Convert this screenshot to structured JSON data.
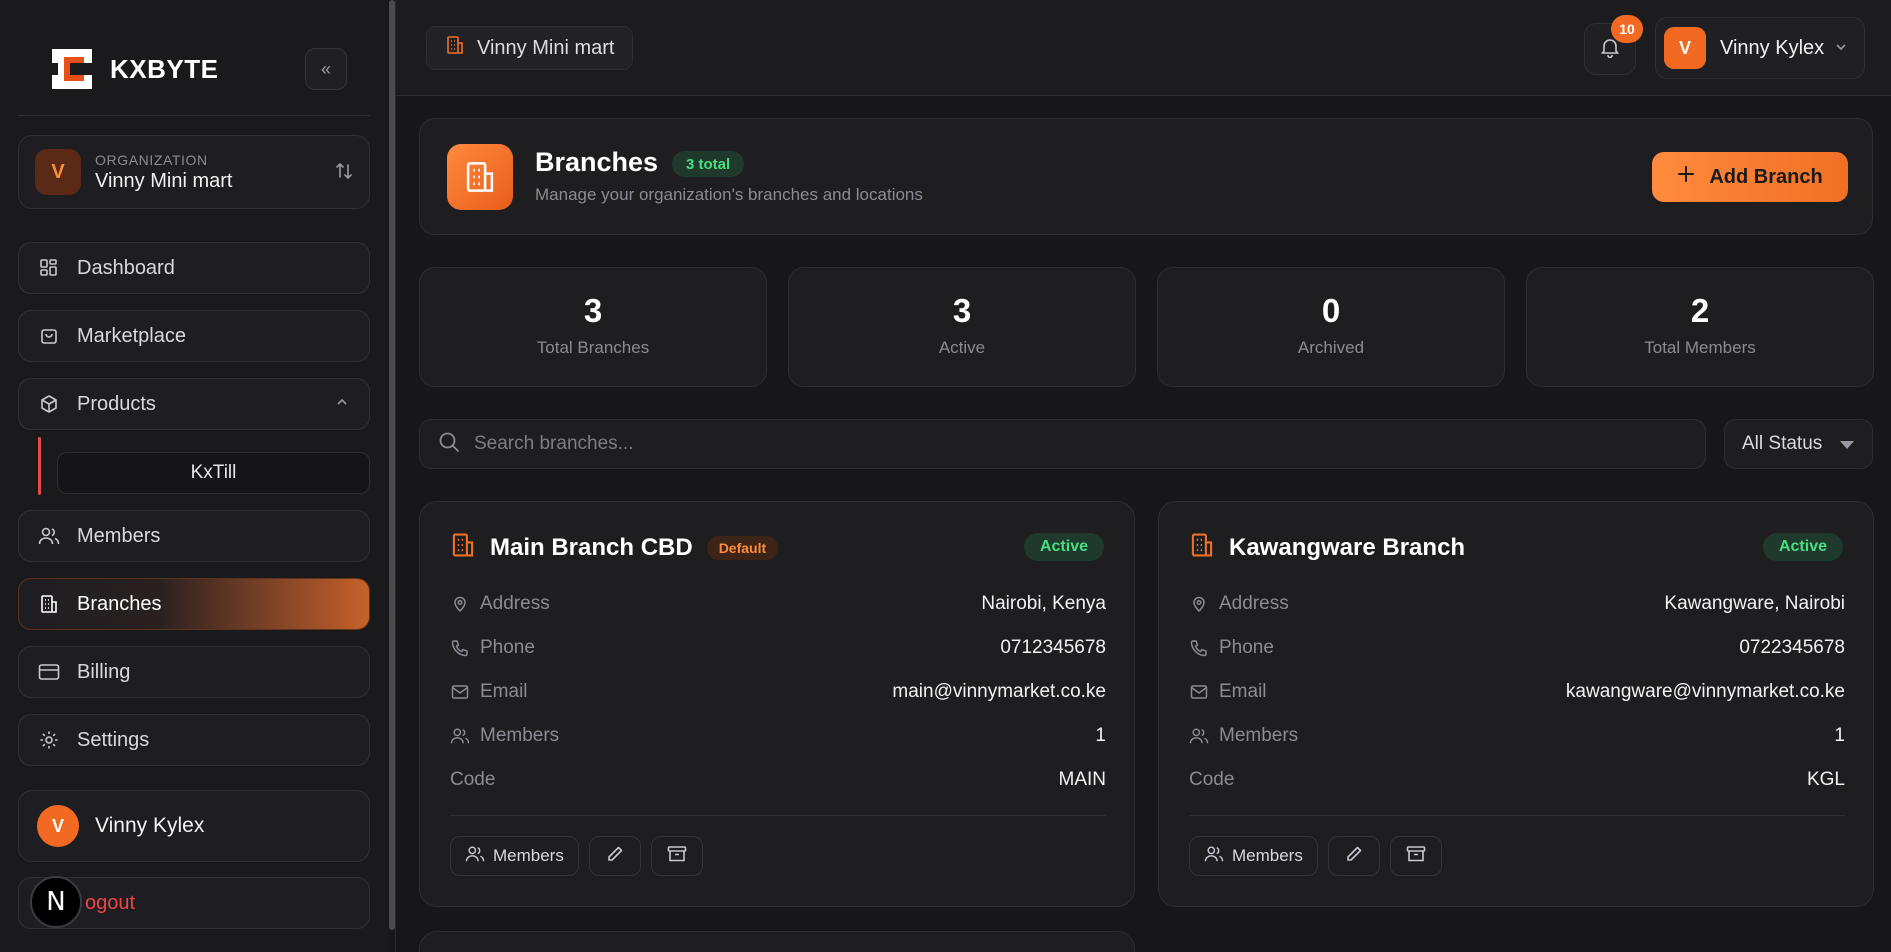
{
  "brand": {
    "name": "KXBYTE"
  },
  "org": {
    "kicker": "ORGANIZATION",
    "name": "Vinny Mini mart",
    "initial": "V"
  },
  "nav": {
    "dashboard": "Dashboard",
    "marketplace": "Marketplace",
    "products": "Products",
    "products_sub": "KxTill",
    "members": "Members",
    "branches": "Branches",
    "billing": "Billing",
    "settings": "Settings"
  },
  "sidebar_user": {
    "name": "Vinny Kylex",
    "initial": "V"
  },
  "logout": {
    "label": "ogout",
    "badge": "N"
  },
  "topbar": {
    "crumb": "Vinny Mini mart",
    "notifications": "10",
    "user_name": "Vinny Kylex",
    "user_initial": "V"
  },
  "header": {
    "title": "Branches",
    "count_pill": "3 total",
    "subtitle": "Manage your organization's branches and locations",
    "add_label": "Add Branch"
  },
  "stats": [
    {
      "value": "3",
      "label": "Total Branches"
    },
    {
      "value": "3",
      "label": "Active"
    },
    {
      "value": "0",
      "label": "Archived"
    },
    {
      "value": "2",
      "label": "Total Members"
    }
  ],
  "search": {
    "placeholder": "Search branches..."
  },
  "status_filter": {
    "selected": "All Status"
  },
  "branches": [
    {
      "name": "Main Branch CBD",
      "default_badge": "Default",
      "status": "Active",
      "labels": {
        "address": "Address",
        "phone": "Phone",
        "email": "Email",
        "members": "Members",
        "code": "Code"
      },
      "address": "Nairobi, Kenya",
      "phone": "0712345678",
      "email": "main@vinnymarket.co.ke",
      "members": "1",
      "code": "MAIN",
      "members_btn": "Members"
    },
    {
      "name": "Kawangware Branch",
      "status": "Active",
      "labels": {
        "address": "Address",
        "phone": "Phone",
        "email": "Email",
        "members": "Members",
        "code": "Code"
      },
      "address": "Kawangware, Nairobi",
      "phone": "0722345678",
      "email": "kawangware@vinnymarket.co.ke",
      "members": "1",
      "code": "KGL",
      "members_btn": "Members"
    }
  ],
  "colors": {
    "accent": "#f26a22",
    "success": "#4ade80",
    "danger": "#ef4444",
    "background": "#17171a"
  }
}
